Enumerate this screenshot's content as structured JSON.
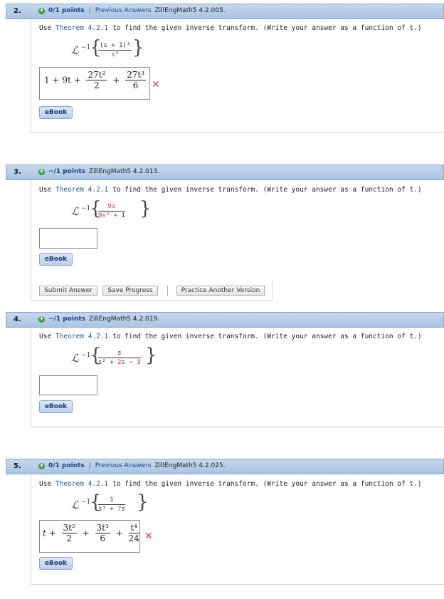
{
  "instruction": {
    "prefix": "Use ",
    "theorem": "Theorem 4.2.1",
    "suffix": " to find the given inverse transform. (Write your answer as a function of t.)"
  },
  "common": {
    "L": "ℒ",
    "sup": "−1",
    "ebook": "eBook",
    "sep": "|",
    "previous_answers": "Previous Answers"
  },
  "questions": [
    {
      "number": "2.",
      "points": "0/1 points",
      "source": "ZillEngMath5 4.2.005.",
      "numerator": "(s + 1)³",
      "denominator": "s⁴",
      "answer": {
        "a": "1 + 9t +",
        "f1n": "27t²",
        "f1d": "2",
        "plus": "+",
        "f2n": "27t³",
        "f2d": "6"
      },
      "mark": "✕"
    },
    {
      "number": "3.",
      "points": "−/1 points",
      "source": "ZillEngMath5 4.2.013.",
      "numerator": "9s",
      "den_a": "9s² + ",
      "den_b": "1",
      "buttons": {
        "submit": "Submit Answer",
        "save": "Save Progress",
        "practice": "Practice Another Version"
      }
    },
    {
      "number": "4.",
      "points": "−/1 points",
      "source": "ZillEngMath5 4.2.019.",
      "numerator": "s",
      "den_a": "s² + ",
      "den_b": "2",
      "den_c": "s − ",
      "den_d": "3"
    },
    {
      "number": "5.",
      "points": "0/1 points",
      "source": "ZillEngMath5 4.2.025.",
      "numerator": "1",
      "den_a": "s³ + ",
      "den_b": "7",
      "den_c": "s",
      "answer": {
        "a": "t +",
        "f1n": "3t²",
        "f1d": "2",
        "plus1": "+",
        "f2n": "3t³",
        "f2d": "6",
        "plus2": "+",
        "f3n": "t⁴",
        "f3d": "24"
      },
      "mark": "✕"
    }
  ]
}
